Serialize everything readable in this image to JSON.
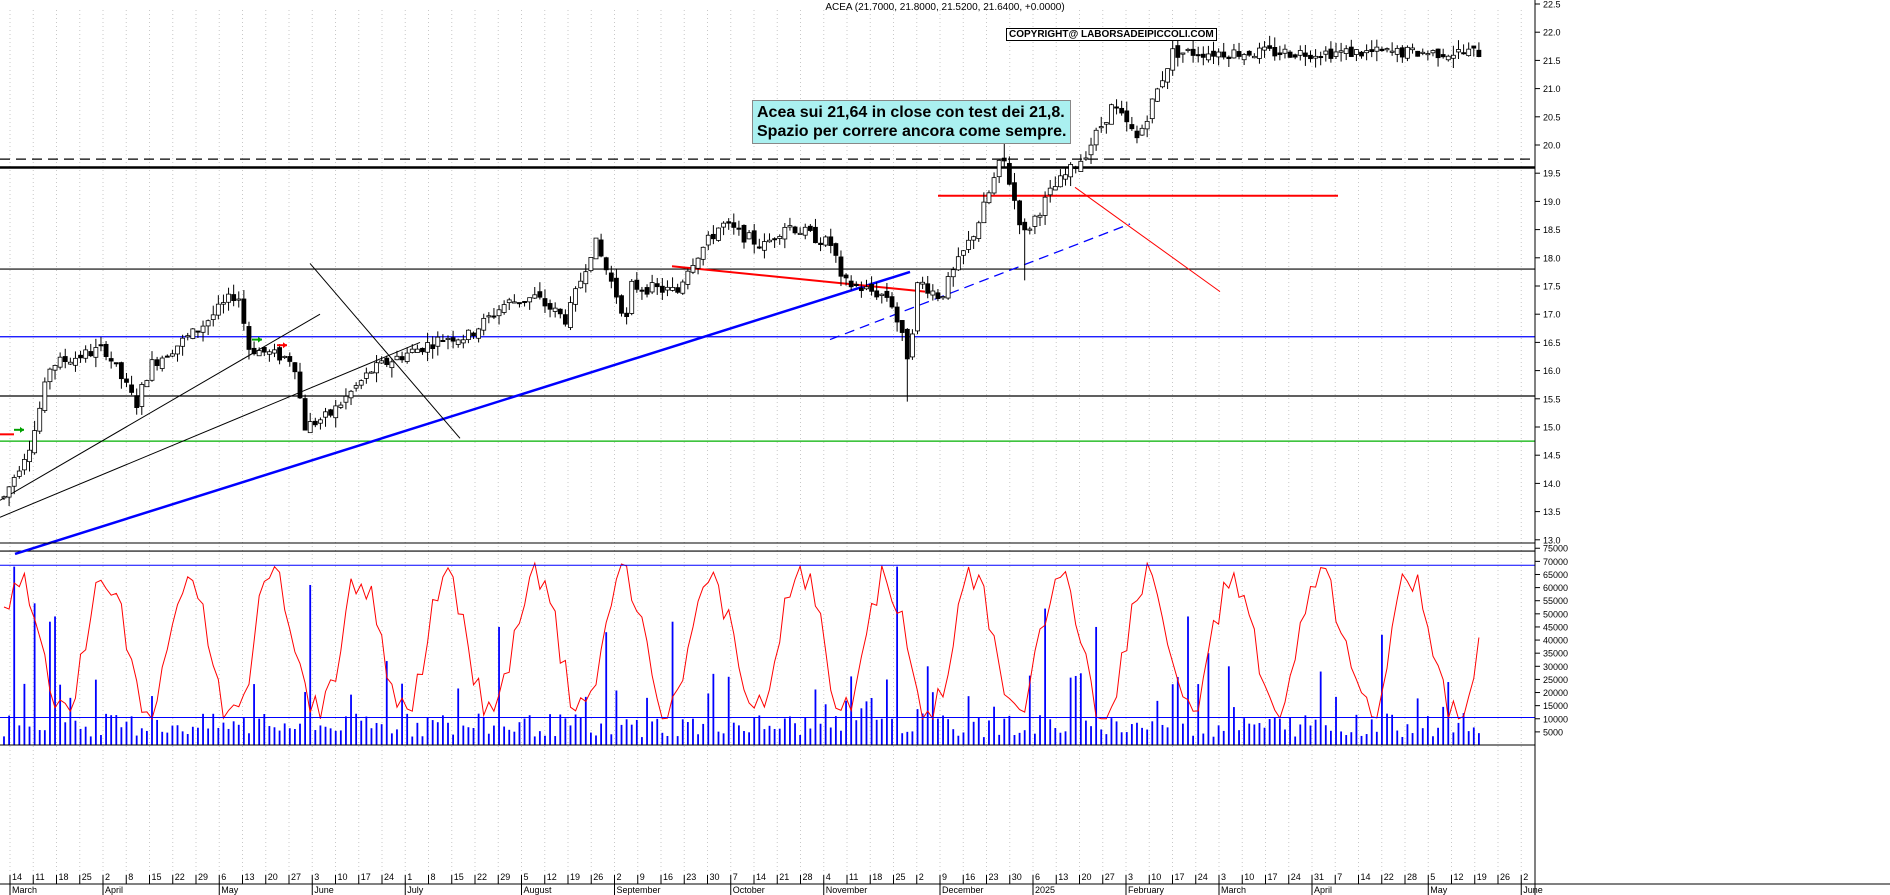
{
  "header": {
    "ticker_line": "ACEA (21.7000, 21.8000, 21.5200, 21.6400, +0.0000)",
    "copyright": "COPYRIGHT@ LABORSADEIPICCOLI.COM"
  },
  "annotation": {
    "line1": "Acea sui 21,64 in close con test dei 21,8.",
    "line2": "Spazio per correre ancora come sempre."
  },
  "colors": {
    "candles": "#000000",
    "support_blue": "#0000ff",
    "resistance_red": "#ff0000",
    "support_green": "#00b000",
    "volume_bars": "#0000ff",
    "oscillator": "#ff0000"
  },
  "chart_data": [
    {
      "type": "candlestick",
      "ticker": "ACEA",
      "ylim": [
        12.8,
        22.3
      ],
      "y_ticks": [
        "13.0",
        "13.5",
        "14.0",
        "14.5",
        "15.0",
        "15.5",
        "16.0",
        "16.5",
        "17.0",
        "17.5",
        "18.0",
        "18.5",
        "19.0",
        "19.5",
        "20.0",
        "20.5",
        "21.0",
        "21.5",
        "22.0",
        "22.5"
      ],
      "last": {
        "open": 21.7,
        "high": 21.8,
        "low": 21.52,
        "close": 21.64,
        "change": 0.0
      },
      "x_month_labels": [
        "March",
        "April",
        "May",
        "June",
        "July",
        "August",
        "September",
        "October",
        "November",
        "December",
        "2025",
        "February",
        "March",
        "April",
        "May",
        "June"
      ],
      "x_day_labels": [
        "14",
        "11",
        "18",
        "25",
        "2",
        "8",
        "15",
        "22",
        "29",
        "6",
        "13",
        "20",
        "27",
        "3",
        "10",
        "17",
        "24",
        "1",
        "8",
        "15",
        "22",
        "29",
        "5",
        "12",
        "19",
        "26",
        "2",
        "9",
        "16",
        "23",
        "30",
        "7",
        "14",
        "21",
        "28",
        "4",
        "11",
        "18",
        "25",
        "2",
        "9",
        "16",
        "23",
        "30",
        "6",
        "13",
        "20",
        "27",
        "3",
        "10",
        "17",
        "24",
        "3",
        "10",
        "17",
        "24",
        "31",
        "7",
        "14",
        "22",
        "28",
        "5",
        "12",
        "19",
        "26",
        "2"
      ],
      "horizontal_levels": [
        {
          "price": 19.75,
          "style": "dashed",
          "color": "#000000"
        },
        {
          "price": 19.6,
          "style": "solid-thick",
          "color": "#000000"
        },
        {
          "price": 17.8,
          "style": "solid",
          "color": "#000000"
        },
        {
          "price": 16.6,
          "style": "solid",
          "color": "#0000ff"
        },
        {
          "price": 15.55,
          "style": "solid",
          "color": "#000000"
        },
        {
          "price": 14.75,
          "style": "solid",
          "color": "#00b000"
        },
        {
          "price": 12.8,
          "style": "solid",
          "color": "#000000"
        }
      ],
      "resistance_segments": [
        {
          "from": [
            "Sep 16",
            17.85
          ],
          "to": [
            "Nov 25",
            17.4
          ]
        },
        {
          "from": [
            "Dec 5",
            19.1
          ],
          "to": [
            "Apr 8",
            19.1
          ]
        }
      ],
      "series_close_approx": [
        {
          "date": "Mar 12",
          "close": 13.75
        },
        {
          "date": "Mar 20",
          "close": 14.8
        },
        {
          "date": "Mar 25",
          "close": 16.1
        },
        {
          "date": "Apr 5",
          "close": 16.3
        },
        {
          "date": "Apr 10",
          "close": 16.4
        },
        {
          "date": "Apr 19",
          "close": 15.4
        },
        {
          "date": "May 2",
          "close": 16.1
        },
        {
          "date": "May 15",
          "close": 16.7
        },
        {
          "date": "May 30",
          "close": 16.4
        },
        {
          "date": "Jun 5",
          "close": 17.4
        },
        {
          "date": "Jun 14",
          "close": 16.3
        },
        {
          "date": "Jun 21",
          "close": 16.2
        },
        {
          "date": "Jun 24",
          "close": 15.0
        },
        {
          "date": "Jul 10",
          "close": 15.2
        },
        {
          "date": "Jul 22",
          "close": 16.0
        },
        {
          "date": "Aug 5",
          "close": 16.2
        },
        {
          "date": "Aug 20",
          "close": 16.6
        },
        {
          "date": "Sep 5",
          "close": 16.6
        },
        {
          "date": "Sep 16",
          "close": 17.2
        },
        {
          "date": "Oct 1",
          "close": 17.3
        },
        {
          "date": "Oct 10",
          "close": 16.9
        },
        {
          "date": "Oct 18",
          "close": 18.3
        },
        {
          "date": "Oct 28",
          "close": 17.5
        },
        {
          "date": "Nov 6",
          "close": 16.8
        },
        {
          "date": "Nov 20",
          "close": 17.4
        },
        {
          "date": "Dec 2",
          "close": 17.8
        },
        {
          "date": "Dec 12",
          "close": 18.6
        },
        {
          "date": "Dec 24",
          "close": 18.2
        },
        {
          "date": "Jan 10",
          "close": 18.6
        },
        {
          "date": "Jan 24",
          "close": 18.2
        },
        {
          "date": "Feb 5",
          "close": 17.6
        },
        {
          "date": "Feb 20",
          "close": 17.3
        },
        {
          "date": "Feb 28",
          "close": 17.6
        },
        {
          "date": "Mar 5",
          "close": 16.2
        },
        {
          "date": "Mar 14",
          "close": 17.3
        },
        {
          "date": "Mar 24",
          "close": 18.5
        },
        {
          "date": "Apr 2",
          "close": 19.8
        },
        {
          "date": "Apr 8",
          "close": 18.4
        },
        {
          "date": "Apr 16",
          "close": 19.2
        },
        {
          "date": "Apr 25",
          "close": 19.8
        },
        {
          "date": "May 5",
          "close": 20.7
        },
        {
          "date": "May 12",
          "close": 20.1
        },
        {
          "date": "May 22",
          "close": 21.64
        }
      ]
    },
    {
      "type": "bar",
      "name": "volume",
      "ylim": [
        0,
        77000
      ],
      "y_ticks": [
        "5000",
        "10000",
        "15000",
        "20000",
        "25000",
        "30000",
        "35000",
        "40000",
        "45000",
        "50000",
        "55000",
        "60000",
        "65000",
        "70000",
        "75000"
      ],
      "reference_levels": [
        68500,
        10500
      ]
    },
    {
      "type": "line",
      "name": "oscillator",
      "ylim": [
        0,
        77000
      ]
    }
  ]
}
